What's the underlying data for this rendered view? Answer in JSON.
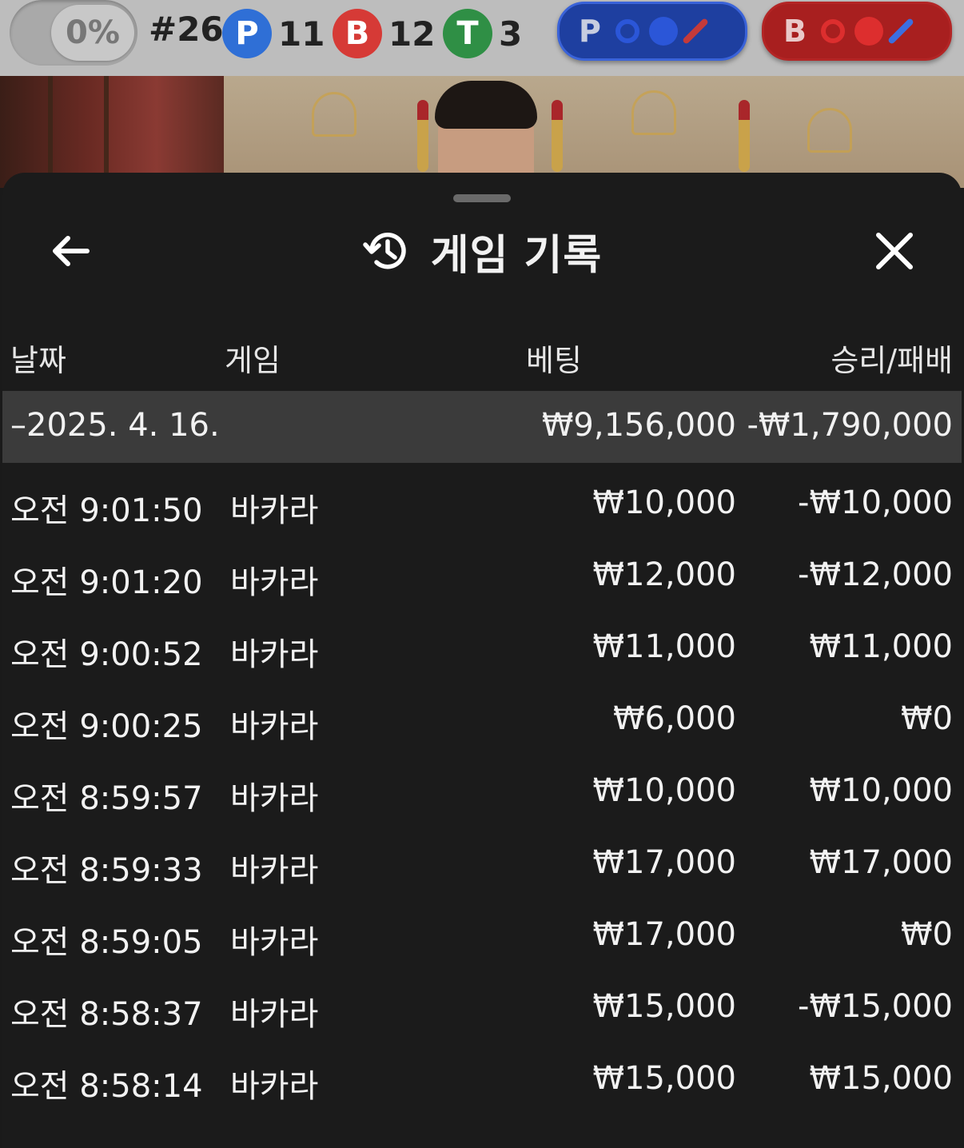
{
  "status_bar": {
    "win_rate": "0%",
    "round": "#26",
    "stats": [
      {
        "letter": "P",
        "count": "11",
        "color": "#2f6fd6"
      },
      {
        "letter": "B",
        "count": "12",
        "color": "#d63a36"
      },
      {
        "letter": "T",
        "count": "3",
        "color": "#2f8f45"
      }
    ],
    "predictions": [
      {
        "letter": "P",
        "bg": "#1e3fa0",
        "border": "#3a63d9",
        "ring": "#2b56d8",
        "dot": "#2b56d8",
        "slash": "#c43a3a"
      },
      {
        "letter": "B",
        "bg": "#a81f1f",
        "border": "#b32525",
        "ring": "#dd2e2e",
        "dot": "#dd2e2e",
        "slash": "#3b6ee0"
      }
    ]
  },
  "history": {
    "title": "게임 기록",
    "columns": {
      "date": "날짜",
      "game": "게임",
      "bet": "베팅",
      "result": "승리/패배"
    },
    "summary": {
      "date": "–2025. 4. 16.",
      "bet": "₩9,156,000",
      "result": "-₩1,790,000"
    },
    "rows": [
      {
        "time": "오전 9:01:50",
        "game": "바카라",
        "bet": "₩10,000",
        "result": "-₩10,000"
      },
      {
        "time": "오전 9:01:20",
        "game": "바카라",
        "bet": "₩12,000",
        "result": "-₩12,000"
      },
      {
        "time": "오전 9:00:52",
        "game": "바카라",
        "bet": "₩11,000",
        "result": "₩11,000"
      },
      {
        "time": "오전 9:00:25",
        "game": "바카라",
        "bet": "₩6,000",
        "result": "₩0"
      },
      {
        "time": "오전 8:59:57",
        "game": "바카라",
        "bet": "₩10,000",
        "result": "₩10,000"
      },
      {
        "time": "오전 8:59:33",
        "game": "바카라",
        "bet": "₩17,000",
        "result": "₩17,000"
      },
      {
        "time": "오전 8:59:05",
        "game": "바카라",
        "bet": "₩17,000",
        "result": "₩0"
      },
      {
        "time": "오전 8:58:37",
        "game": "바카라",
        "bet": "₩15,000",
        "result": "-₩15,000"
      },
      {
        "time": "오전 8:58:14",
        "game": "바카라",
        "bet": "₩15,000",
        "result": "₩15,000"
      }
    ]
  },
  "icons": {
    "back": "arrow-left-icon",
    "history": "history-clock-icon",
    "close": "close-icon"
  }
}
